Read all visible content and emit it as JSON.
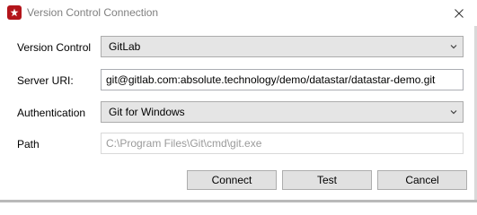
{
  "window": {
    "title": "Version Control Connection",
    "app_icon": "app-logo-icon",
    "close_icon": "close-icon",
    "accent": "#b3151b"
  },
  "form": {
    "version_control": {
      "label": "Version Control",
      "value": "GitLab",
      "icon": "chevron-down-icon"
    },
    "server_uri": {
      "label": "Server URI:",
      "value": "git@gitlab.com:absolute.technology/demo/datastar/datastar-demo.git"
    },
    "authentication": {
      "label": "Authentication",
      "value": "Git for Windows",
      "icon": "chevron-down-icon"
    },
    "path": {
      "label": "Path",
      "placeholder": "C:\\Program Files\\Git\\cmd\\git.exe"
    }
  },
  "buttons": {
    "connect": "Connect",
    "test": "Test",
    "cancel": "Cancel"
  }
}
